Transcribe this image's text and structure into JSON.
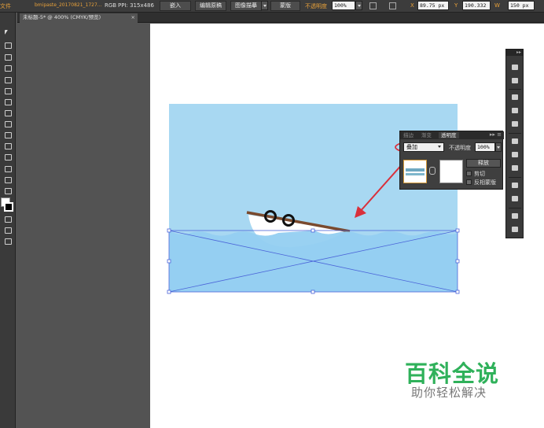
{
  "control_bar": {
    "open_label": "文件",
    "doc_name": "bmipaste_20170821_1727...",
    "color_mode": "RGB",
    "ppi": "PPI: 315x486",
    "embed_label": "嵌入",
    "edit_original_label": "编辑原稿",
    "image_trace_label": "图像描摹",
    "mask_label": "蒙版",
    "opacity_label": "不透明度",
    "opacity_value": "100%",
    "x_value": "89.75 px",
    "y_value": "190.332",
    "w_value": "150 px"
  },
  "tab": {
    "title": "未标题-5* @ 400% (CMYK/预览)",
    "close": "×"
  },
  "transparency_panel": {
    "tabs": [
      "描边",
      "渐变",
      "透明度"
    ],
    "active_tab": "透明度",
    "menu": "▸▸ ≡",
    "blend_mode": "叠加",
    "opacity_label": "不透明度",
    "opacity_value": "100%",
    "release_label": "释放",
    "clip_label": "剪切",
    "invert_mask_label": "反相蒙版"
  },
  "watermark": {
    "title": "百科全说",
    "subtitle": "助你轻松解决"
  },
  "colors": {
    "sky": "#a8d8f2",
    "water": "#93cff1",
    "boat_hull": "#ffffff",
    "oar": "#7a4a2e",
    "annotation": "#d9303b",
    "selection": "#4a63d8"
  }
}
